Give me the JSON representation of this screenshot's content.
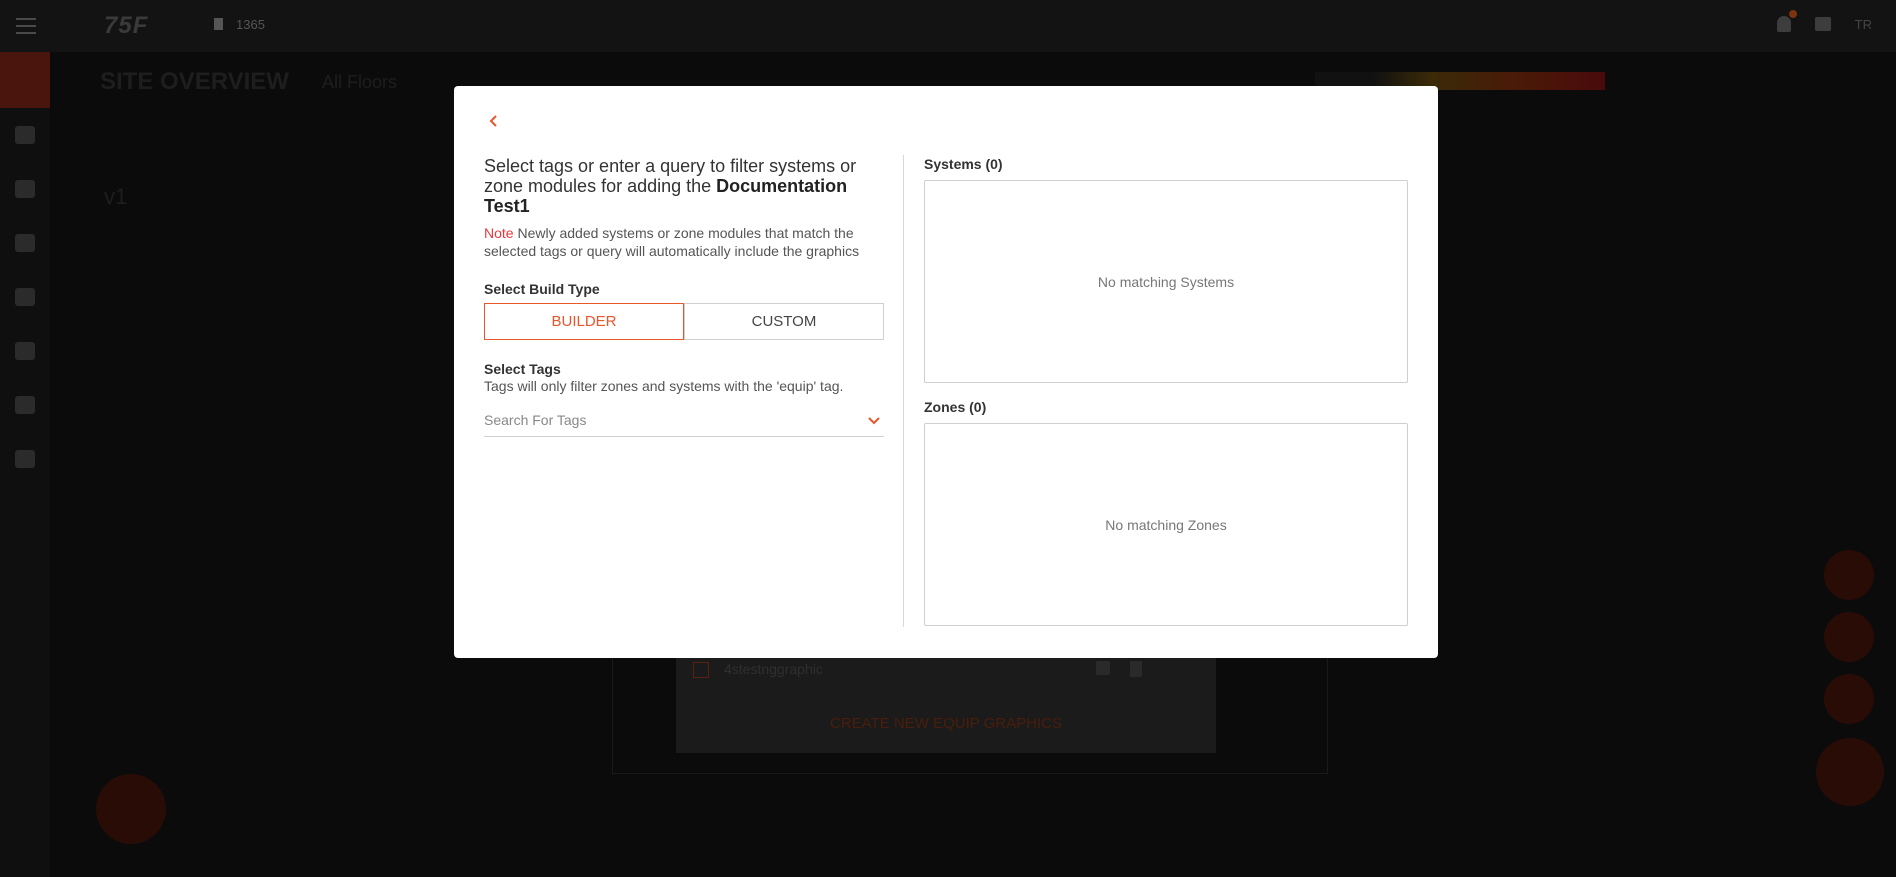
{
  "background": {
    "logo": "75F",
    "site_name": "1365",
    "user": "TR",
    "page_title": "SITE OVERVIEW",
    "floors": "All Floors",
    "version": "v1",
    "list_item": "4stestnggraphic",
    "create_button": "CREATE NEW EQUIP GRAPHICS"
  },
  "modal": {
    "intro_text": "Select tags or enter a query to filter systems or zone modules for adding the ",
    "graphic_name": "Documentation Test1",
    "note_label": "Note",
    "note_text": " Newly added systems or zone modules that match the selected tags or query will automatically include the graphics",
    "build_type_label": "Select Build Type",
    "builder_label": "BUILDER",
    "custom_label": "CUSTOM",
    "tags_label": "Select Tags",
    "tags_help": "Tags will only filter zones and systems with the 'equip' tag.",
    "tags_placeholder": "Search For Tags",
    "systems_title": "Systems (0)",
    "systems_empty": "No matching Systems",
    "zones_title": "Zones (0)",
    "zones_empty": "No matching Zones"
  },
  "colors": {
    "accent": "#e8562a",
    "note_red": "#e8383d"
  }
}
